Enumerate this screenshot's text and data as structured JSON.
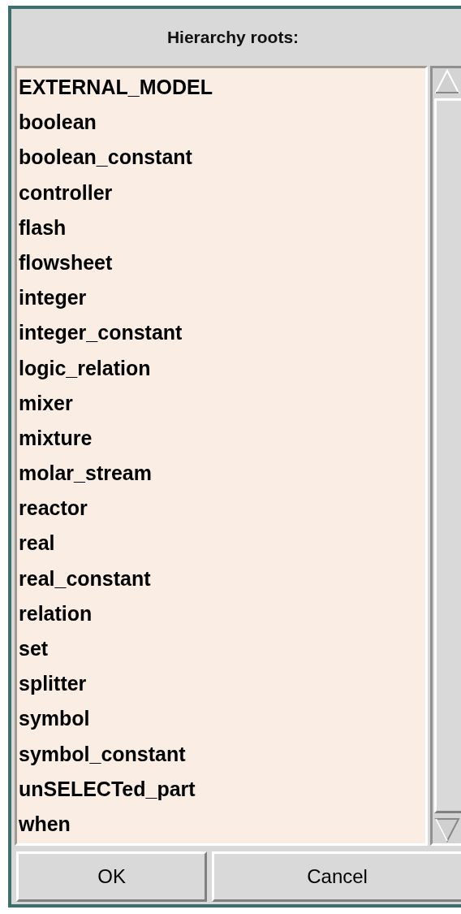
{
  "dialog": {
    "title": "Hierarchy roots:"
  },
  "list": {
    "items": [
      "EXTERNAL_MODEL",
      "boolean",
      "boolean_constant",
      "controller",
      "flash",
      "flowsheet",
      "integer",
      "integer_constant",
      "logic_relation",
      "mixer",
      "mixture",
      "molar_stream",
      "reactor",
      "real",
      "real_constant",
      "relation",
      "set",
      "splitter",
      "symbol",
      "symbol_constant",
      "unSELECTed_part",
      "when"
    ]
  },
  "buttons": [
    "OK",
    "Cancel"
  ]
}
